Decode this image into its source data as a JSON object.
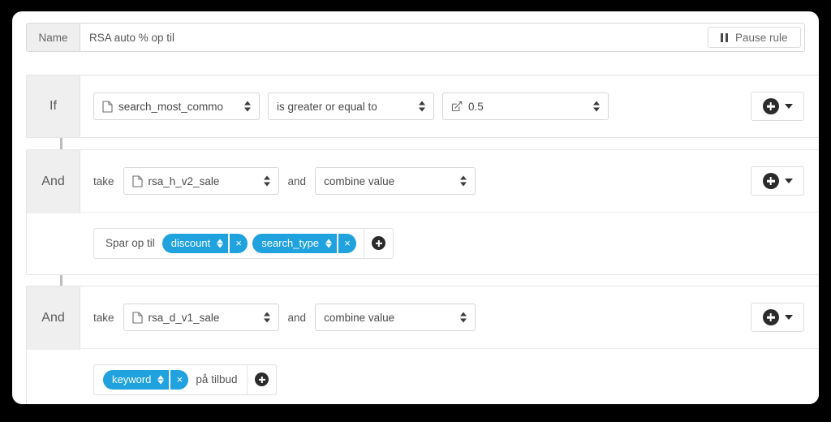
{
  "name_bar": {
    "label": "Name",
    "value": "RSA auto % op til",
    "pause_label": "Pause rule",
    "pause_icon": "pause-icon"
  },
  "colors": {
    "tag_blue": "#1fa2dd",
    "label_gray": "#efefef",
    "connector": "#bcbcbc"
  },
  "blocks": [
    {
      "operator": "If",
      "main": {
        "field": {
          "icon": "document-icon",
          "value": "search_most_commo"
        },
        "comparator": {
          "value": "is greater or equal to"
        },
        "amount": {
          "icon": "edit-square-icon",
          "value": "0.5"
        }
      },
      "add_button": {
        "icon": "plus-circle-icon",
        "caret": "caret-down-icon"
      }
    },
    {
      "operator": "And",
      "main": {
        "take_label": "take",
        "source": {
          "icon": "document-icon",
          "value": "rsa_h_v2_sale"
        },
        "and_label": "and",
        "combine": {
          "value": "combine value"
        }
      },
      "add_button": {
        "icon": "plus-circle-icon",
        "caret": "caret-down-icon"
      },
      "tags": {
        "prefix_text": "Spar op til",
        "suffix_text": "",
        "items": [
          {
            "label": "discount",
            "remove": "×"
          },
          {
            "label": "search_type",
            "remove": "×"
          }
        ],
        "add_icon": "plus-circle-icon"
      }
    },
    {
      "operator": "And",
      "main": {
        "take_label": "take",
        "source": {
          "icon": "document-icon",
          "value": "rsa_d_v1_sale"
        },
        "and_label": "and",
        "combine": {
          "value": "combine value"
        }
      },
      "add_button": {
        "icon": "plus-circle-icon",
        "caret": "caret-down-icon"
      },
      "tags": {
        "prefix_text": "",
        "suffix_text": "på tilbud",
        "items": [
          {
            "label": "keyword",
            "remove": "×"
          }
        ],
        "add_icon": "plus-circle-icon"
      }
    }
  ]
}
